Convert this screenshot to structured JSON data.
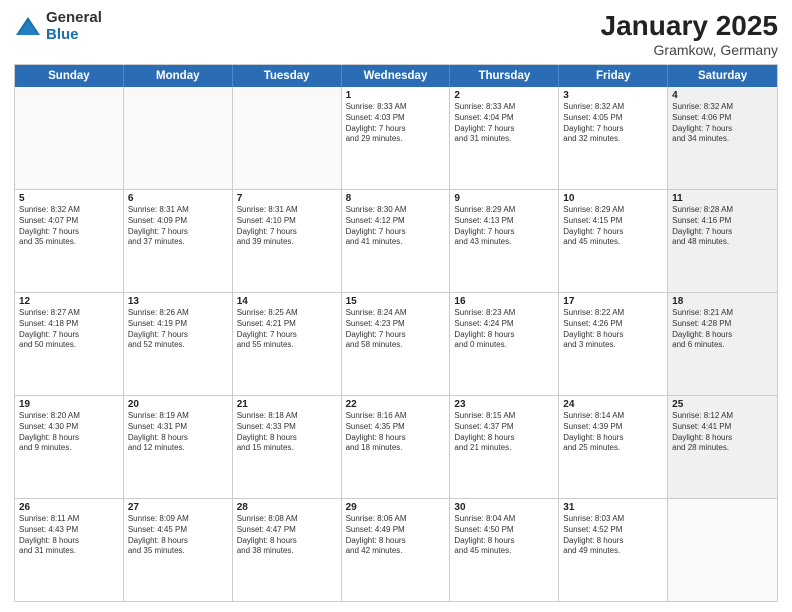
{
  "logo": {
    "general": "General",
    "blue": "Blue"
  },
  "title": {
    "month": "January 2025",
    "location": "Gramkow, Germany"
  },
  "weekdays": [
    "Sunday",
    "Monday",
    "Tuesday",
    "Wednesday",
    "Thursday",
    "Friday",
    "Saturday"
  ],
  "weeks": [
    [
      {
        "day": "",
        "text": "",
        "empty": true
      },
      {
        "day": "",
        "text": "",
        "empty": true
      },
      {
        "day": "",
        "text": "",
        "empty": true
      },
      {
        "day": "1",
        "text": "Sunrise: 8:33 AM\nSunset: 4:03 PM\nDaylight: 7 hours\nand 29 minutes."
      },
      {
        "day": "2",
        "text": "Sunrise: 8:33 AM\nSunset: 4:04 PM\nDaylight: 7 hours\nand 31 minutes."
      },
      {
        "day": "3",
        "text": "Sunrise: 8:32 AM\nSunset: 4:05 PM\nDaylight: 7 hours\nand 32 minutes."
      },
      {
        "day": "4",
        "text": "Sunrise: 8:32 AM\nSunset: 4:06 PM\nDaylight: 7 hours\nand 34 minutes.",
        "shaded": true
      }
    ],
    [
      {
        "day": "5",
        "text": "Sunrise: 8:32 AM\nSunset: 4:07 PM\nDaylight: 7 hours\nand 35 minutes."
      },
      {
        "day": "6",
        "text": "Sunrise: 8:31 AM\nSunset: 4:09 PM\nDaylight: 7 hours\nand 37 minutes."
      },
      {
        "day": "7",
        "text": "Sunrise: 8:31 AM\nSunset: 4:10 PM\nDaylight: 7 hours\nand 39 minutes."
      },
      {
        "day": "8",
        "text": "Sunrise: 8:30 AM\nSunset: 4:12 PM\nDaylight: 7 hours\nand 41 minutes."
      },
      {
        "day": "9",
        "text": "Sunrise: 8:29 AM\nSunset: 4:13 PM\nDaylight: 7 hours\nand 43 minutes."
      },
      {
        "day": "10",
        "text": "Sunrise: 8:29 AM\nSunset: 4:15 PM\nDaylight: 7 hours\nand 45 minutes."
      },
      {
        "day": "11",
        "text": "Sunrise: 8:28 AM\nSunset: 4:16 PM\nDaylight: 7 hours\nand 48 minutes.",
        "shaded": true
      }
    ],
    [
      {
        "day": "12",
        "text": "Sunrise: 8:27 AM\nSunset: 4:18 PM\nDaylight: 7 hours\nand 50 minutes."
      },
      {
        "day": "13",
        "text": "Sunrise: 8:26 AM\nSunset: 4:19 PM\nDaylight: 7 hours\nand 52 minutes."
      },
      {
        "day": "14",
        "text": "Sunrise: 8:25 AM\nSunset: 4:21 PM\nDaylight: 7 hours\nand 55 minutes."
      },
      {
        "day": "15",
        "text": "Sunrise: 8:24 AM\nSunset: 4:23 PM\nDaylight: 7 hours\nand 58 minutes."
      },
      {
        "day": "16",
        "text": "Sunrise: 8:23 AM\nSunset: 4:24 PM\nDaylight: 8 hours\nand 0 minutes."
      },
      {
        "day": "17",
        "text": "Sunrise: 8:22 AM\nSunset: 4:26 PM\nDaylight: 8 hours\nand 3 minutes."
      },
      {
        "day": "18",
        "text": "Sunrise: 8:21 AM\nSunset: 4:28 PM\nDaylight: 8 hours\nand 6 minutes.",
        "shaded": true
      }
    ],
    [
      {
        "day": "19",
        "text": "Sunrise: 8:20 AM\nSunset: 4:30 PM\nDaylight: 8 hours\nand 9 minutes."
      },
      {
        "day": "20",
        "text": "Sunrise: 8:19 AM\nSunset: 4:31 PM\nDaylight: 8 hours\nand 12 minutes."
      },
      {
        "day": "21",
        "text": "Sunrise: 8:18 AM\nSunset: 4:33 PM\nDaylight: 8 hours\nand 15 minutes."
      },
      {
        "day": "22",
        "text": "Sunrise: 8:16 AM\nSunset: 4:35 PM\nDaylight: 8 hours\nand 18 minutes."
      },
      {
        "day": "23",
        "text": "Sunrise: 8:15 AM\nSunset: 4:37 PM\nDaylight: 8 hours\nand 21 minutes."
      },
      {
        "day": "24",
        "text": "Sunrise: 8:14 AM\nSunset: 4:39 PM\nDaylight: 8 hours\nand 25 minutes."
      },
      {
        "day": "25",
        "text": "Sunrise: 8:12 AM\nSunset: 4:41 PM\nDaylight: 8 hours\nand 28 minutes.",
        "shaded": true
      }
    ],
    [
      {
        "day": "26",
        "text": "Sunrise: 8:11 AM\nSunset: 4:43 PM\nDaylight: 8 hours\nand 31 minutes."
      },
      {
        "day": "27",
        "text": "Sunrise: 8:09 AM\nSunset: 4:45 PM\nDaylight: 8 hours\nand 35 minutes."
      },
      {
        "day": "28",
        "text": "Sunrise: 8:08 AM\nSunset: 4:47 PM\nDaylight: 8 hours\nand 38 minutes."
      },
      {
        "day": "29",
        "text": "Sunrise: 8:06 AM\nSunset: 4:49 PM\nDaylight: 8 hours\nand 42 minutes."
      },
      {
        "day": "30",
        "text": "Sunrise: 8:04 AM\nSunset: 4:50 PM\nDaylight: 8 hours\nand 45 minutes."
      },
      {
        "day": "31",
        "text": "Sunrise: 8:03 AM\nSunset: 4:52 PM\nDaylight: 8 hours\nand 49 minutes."
      },
      {
        "day": "",
        "text": "",
        "empty": true,
        "shaded": true
      }
    ]
  ]
}
